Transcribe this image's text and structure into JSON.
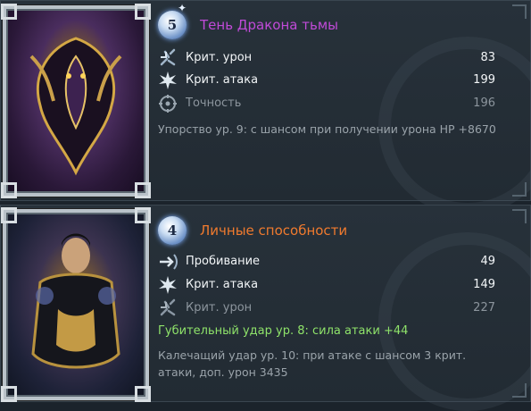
{
  "cards": [
    {
      "rank": "5",
      "title": "Тень Дракона тьмы",
      "title_color": "#c04ad8",
      "stats": [
        {
          "icon": "crit-damage-icon",
          "label": "Крит. урон",
          "value": "83",
          "dim": false
        },
        {
          "icon": "crit-attack-icon",
          "label": "Крит. атака",
          "value": "199",
          "dim": false
        },
        {
          "icon": "accuracy-icon",
          "label": "Точность",
          "value": "196",
          "dim": true
        }
      ],
      "effects": [
        {
          "text": "Упорство ур. 9: с шансом при получении урона HP +8670",
          "color": "#9aa3aa"
        }
      ]
    },
    {
      "rank": "4",
      "title": "Личные способности",
      "title_color": "#f07a2e",
      "stats": [
        {
          "icon": "penetration-icon",
          "label": "Пробивание",
          "value": "49",
          "dim": false
        },
        {
          "icon": "crit-attack-icon",
          "label": "Крит. атака",
          "value": "149",
          "dim": false
        },
        {
          "icon": "crit-damage-icon",
          "label": "Крит. урон",
          "value": "227",
          "dim": true
        }
      ],
      "effects": [
        {
          "text": "Губительный удар ур. 8: сила атаки +44",
          "color": "#8fe36a"
        },
        {
          "text": "Калечащий удар ур. 10: при атаке с шансом 3 крит. атаки, доп. урон 3435",
          "color": "#9aa3aa"
        }
      ]
    }
  ]
}
